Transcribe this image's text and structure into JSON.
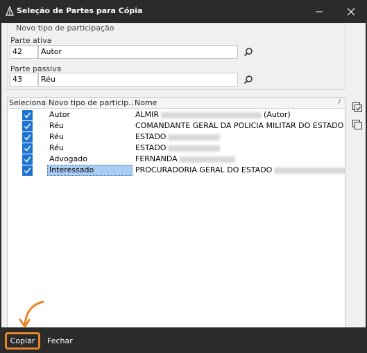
{
  "window": {
    "title": "Seleção de Partes para Cópia",
    "minimize_glyph": "—",
    "close_glyph": "✕"
  },
  "group": {
    "legend": "Novo tipo de participação",
    "parte_ativa_label": "Parte ativa",
    "parte_ativa_code": "42",
    "parte_ativa_name": "Autor",
    "parte_passiva_label": "Parte passiva",
    "parte_passiva_code": "43",
    "parte_passiva_name": "Réu"
  },
  "grid": {
    "headers": {
      "selecionar": "Selecionar",
      "tipo": "Novo tipo de particip...",
      "nome": "Nome",
      "sort_glyph": "/"
    },
    "rows": [
      {
        "checked": true,
        "tipo": "Autor",
        "nome": "ALMIR",
        "nome_suffix": "(Autor)"
      },
      {
        "checked": true,
        "tipo": "Réu",
        "nome": "COMANDANTE GERAL DA POLICIA MILITAR DO ESTADO DO P",
        "nome_suffix": ""
      },
      {
        "checked": true,
        "tipo": "Réu",
        "nome": "ESTADO",
        "nome_suffix": ""
      },
      {
        "checked": true,
        "tipo": "Réu",
        "nome": "ESTADO",
        "nome_suffix": ""
      },
      {
        "checked": true,
        "tipo": "Advogado",
        "nome": "FERNANDA",
        "nome_suffix": ""
      },
      {
        "checked": true,
        "tipo": "Interessado",
        "nome": "PROCURADORIA GERAL DO ESTADO",
        "nome_suffix": ""
      }
    ]
  },
  "buttons": {
    "copiar": "Copiar",
    "fechar": "Fechar"
  },
  "colors": {
    "accent": "#1e74d0",
    "highlight": "#e8862a",
    "titlebar": "#2b2b2b"
  }
}
